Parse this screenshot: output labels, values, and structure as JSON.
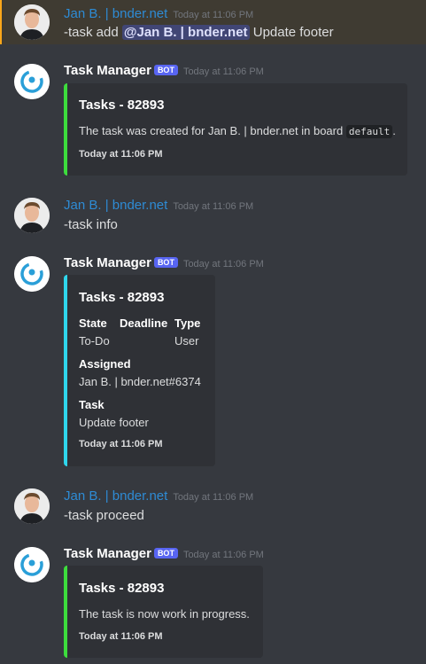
{
  "messages": [
    {
      "author": "Jan B. | bnder.net",
      "timestamp": "Today at 11:06 PM",
      "prefix": "-task add ",
      "mention": "@Jan B. | bnder.net",
      "suffix": " Update footer"
    },
    {
      "author": "Task Manager",
      "badge": "BOT",
      "timestamp": "Today at 11:06 PM",
      "embed": {
        "title": "Tasks - 82893",
        "desc_prefix": "The task was created for Jan B. | bnder.net in board ",
        "code": "default",
        "desc_suffix": ".",
        "footer": "Today at 11:06 PM"
      }
    },
    {
      "author": "Jan B. | bnder.net",
      "timestamp": "Today at 11:06 PM",
      "content": "-task info"
    },
    {
      "author": "Task Manager",
      "badge": "BOT",
      "timestamp": "Today at 11:06 PM",
      "embed": {
        "title": "Tasks - 82893",
        "fields": {
          "state_name": "State",
          "state_value": "To-Do",
          "deadline_name": "Deadline",
          "type_name": "Type",
          "type_value": "User",
          "assigned_name": "Assigned",
          "assigned_value": "Jan B. | bnder.net#6374",
          "task_name": "Task",
          "task_value": "Update footer"
        },
        "footer": "Today at 11:06 PM"
      }
    },
    {
      "author": "Jan B. | bnder.net",
      "timestamp": "Today at 11:06 PM",
      "content": "-task proceed"
    },
    {
      "author": "Task Manager",
      "badge": "BOT",
      "timestamp": "Today at 11:06 PM",
      "embed": {
        "title": "Tasks - 82893",
        "desc": "The task is now work in progress.",
        "footer": "Today at 11:06 PM"
      }
    }
  ],
  "colors": {
    "background": "#36393f",
    "embed_bg": "#2f3136",
    "green_bar": "#3ddc3d",
    "cyan_bar": "#2fd6ec",
    "user_name": "#2e8bd4",
    "mention_bg": "#414675",
    "badge": "#5865f2"
  }
}
